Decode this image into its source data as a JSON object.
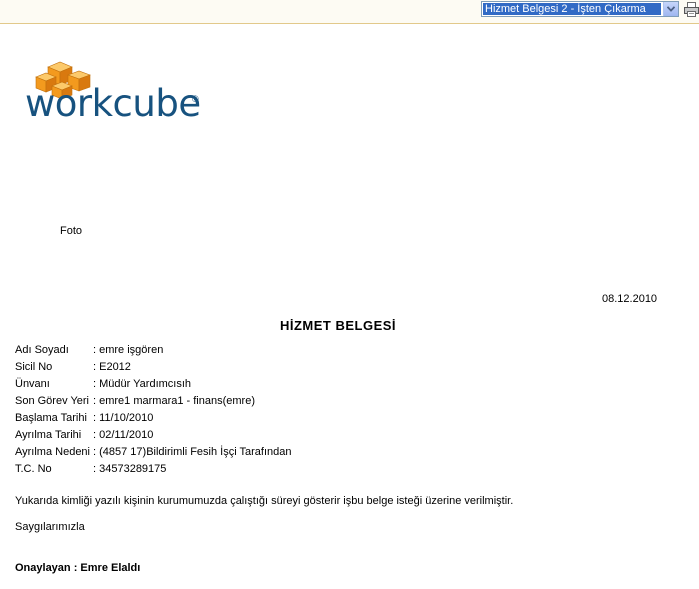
{
  "toolbar": {
    "template_select": {
      "value": "Hizmet Belgesi 2 - İşten Çıkarma"
    },
    "icons": {
      "dropdown": "chevron-down-icon",
      "print": "printer-icon"
    }
  },
  "logo": {
    "text": "workcube",
    "reg": "®"
  },
  "document": {
    "photo_label": "Foto",
    "date": "08.12.2010",
    "title": "HİZMET BELGESİ",
    "fields": [
      {
        "label": "Adı Soyadı",
        "value": ": emre işgören"
      },
      {
        "label": "Sicil No",
        "value": ": E2012"
      },
      {
        "label": "Ünvanı",
        "value": ": Müdür Yardımcısıh"
      },
      {
        "label": "Son Görev Yeri",
        "value": ": emre1 marmara1 - finans(emre)"
      },
      {
        "label": "Başlama Tarihi",
        "value": ": 11/10/2010"
      },
      {
        "label": "Ayrılma Tarihi",
        "value": ": 02/11/2010"
      },
      {
        "label": "Ayrılma Nedeni",
        "value": ": (4857 17)Bildirimli Fesih İşçi Tarafından"
      },
      {
        "label": "T.C. No",
        "value": ": 34573289175"
      }
    ],
    "paragraph": "Yukarıda kimliği yazılı kişinin kurumumuzda çalıştığı süreyi gösterir işbu belge isteği üzerine verilmiştir.",
    "regards": "Saygılarımızla",
    "approver": "Onaylayan : Emre Elaldı"
  },
  "colors": {
    "logo_blue": "#17527f",
    "logo_orange": "#f39a1e",
    "select_highlight": "#316ac5"
  }
}
